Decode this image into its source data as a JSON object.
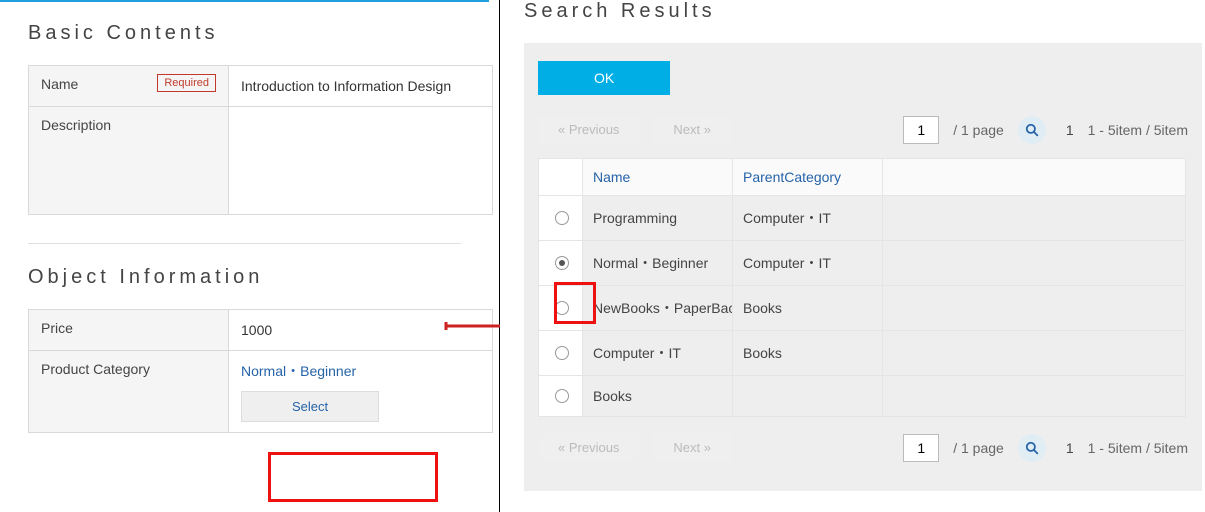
{
  "left": {
    "section1_title": "Basic Contents",
    "name_label": "Name",
    "required_tag": "Required",
    "name_value": "Introduction to Information Design",
    "description_label": "Description",
    "description_value": "",
    "section2_title": "Object Information",
    "price_label": "Price",
    "price_value": "1000",
    "category_label": "Product Category",
    "category_value": "Normal・Beginner",
    "select_button": "Select"
  },
  "right": {
    "title": "Search Results",
    "ok_button": "OK",
    "prev_label": "«   Previous",
    "next_label": "Next   »",
    "page_value": "1",
    "page_total": "/  1 page",
    "count_prefix": "1",
    "count_text": "1 - 5item / 5item",
    "col_name": "Name",
    "col_parent": "ParentCategory",
    "rows": [
      {
        "name": "Programming",
        "parent": "Computer・IT",
        "selected": false
      },
      {
        "name": "Normal・Beginner",
        "parent": "Computer・IT",
        "selected": true
      },
      {
        "name": "NewBooks・PaperBacks",
        "parent": "Books",
        "selected": false
      },
      {
        "name": "Computer・IT",
        "parent": "Books",
        "selected": false
      },
      {
        "name": "Books",
        "parent": "",
        "selected": false
      }
    ]
  }
}
